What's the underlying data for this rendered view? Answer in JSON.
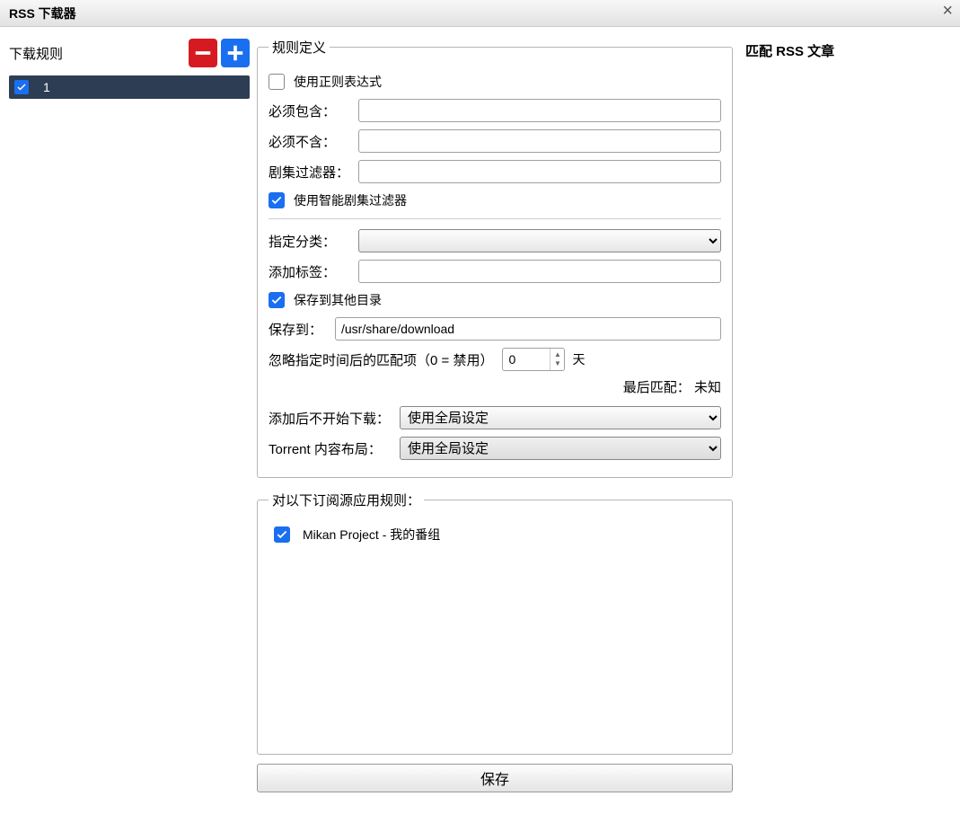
{
  "titlebar": {
    "title": "RSS 下载器"
  },
  "left": {
    "header_label": "下载规则",
    "rules": [
      {
        "name": "1",
        "enabled": true
      }
    ]
  },
  "def": {
    "legend": "规则定义",
    "use_regex": {
      "label": "使用正则表达式",
      "checked": false
    },
    "must_contain": {
      "label": "必须包含：",
      "value": ""
    },
    "must_not_contain": {
      "label": "必须不含：",
      "value": ""
    },
    "episode_filter": {
      "label": "剧集过滤器：",
      "value": ""
    },
    "smart_filter": {
      "label": "使用智能剧集过滤器",
      "checked": true
    },
    "category": {
      "label": "指定分类：",
      "value": ""
    },
    "tags": {
      "label": "添加标签：",
      "value": ""
    },
    "save_other": {
      "label": "保存到其他目录",
      "checked": true
    },
    "save_to": {
      "label": "保存到：",
      "value": "/usr/share/download"
    },
    "ignore_days": {
      "label": "忽略指定时间后的匹配项（0 = 禁用）",
      "value": "0",
      "suffix": "天"
    },
    "last_match": {
      "label": "最后匹配：",
      "value": "未知"
    },
    "add_paused": {
      "label": "添加后不开始下载：",
      "value": "使用全局设定"
    },
    "content_layout": {
      "label": "Torrent 内容布局：",
      "value": "使用全局设定"
    }
  },
  "feeds": {
    "legend": "对以下订阅源应用规则：",
    "items": [
      {
        "name": "Mikan Project - 我的番组",
        "checked": true
      }
    ]
  },
  "save_button": "保存",
  "right": {
    "header": "匹配 RSS 文章"
  }
}
